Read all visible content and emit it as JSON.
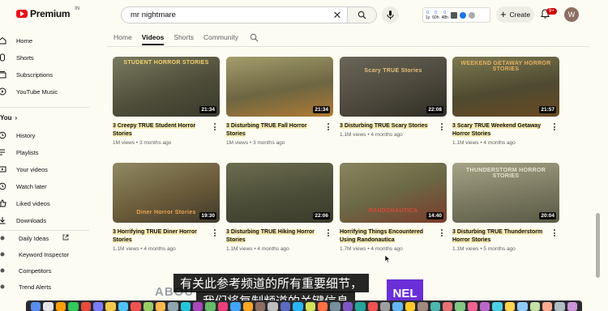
{
  "header": {
    "logo_text": "Premium",
    "region": "IN",
    "search_value": "mr nightmare",
    "ext_stats": [
      {
        "value": "0",
        "label": "1y"
      },
      {
        "value": "0",
        "label": "60h"
      },
      {
        "value": "0",
        "label": "48h"
      }
    ],
    "create_label": "Create",
    "notifications": "9+",
    "avatar_letter": "W"
  },
  "sidebar": {
    "items": [
      {
        "label": "Home",
        "icon": "home-icon"
      },
      {
        "label": "Shorts",
        "icon": "shorts-icon"
      },
      {
        "label": "Subscriptions",
        "icon": "subscriptions-icon"
      },
      {
        "label": "YouTube Music",
        "icon": "youtube-music-icon"
      }
    ],
    "you_label": "You",
    "you_items": [
      {
        "label": "History",
        "icon": "history-icon"
      },
      {
        "label": "Playlists",
        "icon": "playlists-icon"
      },
      {
        "label": "Your videos",
        "icon": "your-videos-icon"
      },
      {
        "label": "Watch later",
        "icon": "watch-later-icon"
      },
      {
        "label": "Liked videos",
        "icon": "liked-videos-icon"
      },
      {
        "label": "Downloads",
        "icon": "downloads-icon"
      }
    ],
    "ext_items": [
      {
        "label": "Daily Ideas"
      },
      {
        "label": "Keyword Inspector"
      },
      {
        "label": "Competitors"
      },
      {
        "label": "Trend Alerts"
      }
    ]
  },
  "tabs": [
    "Home",
    "Videos",
    "Shorts",
    "Community"
  ],
  "active_tab": "Videos",
  "videos": [
    {
      "title": "3 Creepy TRUE Student Horror Stories",
      "views": "1M views",
      "age": "3 months ago",
      "duration": "21:34",
      "art": "STUDENT HORROR STORIES",
      "art_color": "#f4d36a"
    },
    {
      "title": "3 Disturbing TRUE Fall Horror Stories",
      "views": "1M views",
      "age": "3 months ago",
      "duration": "21:34",
      "art": "",
      "art_color": "#f4d36a"
    },
    {
      "title": "3 Disturbing TRUE Scary Stories",
      "views": "1.1M views",
      "age": "4 months ago",
      "duration": "22:08",
      "art": "Scary TRUE Stories",
      "art_color": "#e7c27a"
    },
    {
      "title": "3 Scary TRUE Weekend Getaway Horror Stories",
      "views": "1.1M views",
      "age": "4 months ago",
      "duration": "21:57",
      "art": "WEEKEND GETAWAY HORROR STORIES",
      "art_color": "#e8b05e"
    },
    {
      "title": "3 Horrifying TRUE Diner Horror Stories",
      "views": "1.1M views",
      "age": "4 months ago",
      "duration": "19:30",
      "art": "Diner Horror Stories",
      "art_color": "#f0a24a"
    },
    {
      "title": "3 Disturbing TRUE Hiking Horror Stories",
      "views": "1.1M views",
      "age": "4 months ago",
      "duration": "22:06",
      "art": "",
      "art_color": "#f4d36a"
    },
    {
      "title": "Horrifying Things Encountered Using Randonautica",
      "views": "1.7M views",
      "age": "4 months ago",
      "duration": "14:40",
      "art": "RANDONAUTICA",
      "art_color": "#d64a3a"
    },
    {
      "title": "3 Disturbing TRUE Thunderstorm Horror Stories",
      "views": "1.1M views",
      "age": "5 months ago",
      "duration": "20:04",
      "art": "THUNDERSTORM HORROR STORIES",
      "art_color": "#e6e2d0"
    }
  ],
  "subtitles": {
    "line1": "有关此参考频道的所有重要细节，",
    "line2": "我们将复制频道的关键信息",
    "about_partial": "ABOU",
    "brand_partial": "NEL"
  },
  "colors": {
    "page_bg": "#fdfcf3",
    "brand_red": "#e8101a",
    "title_highlight": "#f7ecb2",
    "badge_red": "#cc0000",
    "overlay_purple": "#6a2fd6"
  }
}
